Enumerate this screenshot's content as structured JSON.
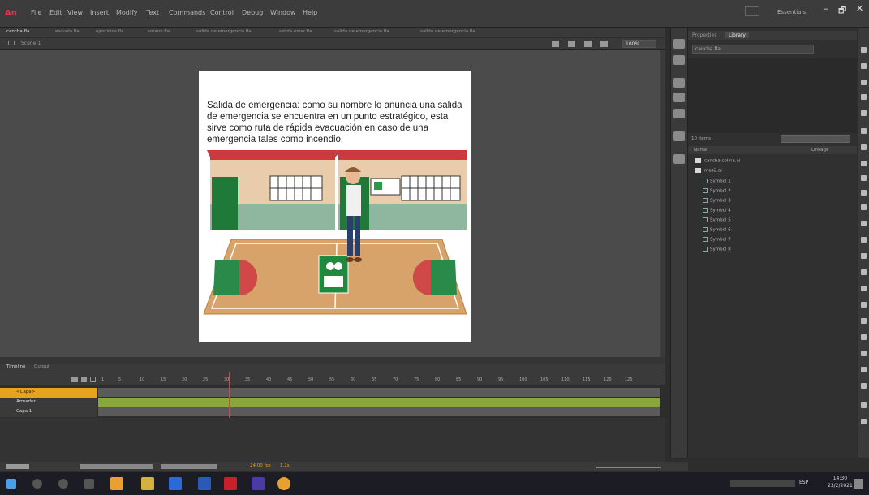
{
  "menubar": {
    "logo": "An",
    "items": [
      "File",
      "Edit",
      "View",
      "Insert",
      "Modify",
      "Text",
      "Commands",
      "Control",
      "Debug",
      "Window",
      "Help"
    ],
    "workspace": "Essentials",
    "win_buttons": [
      "–",
      "🗗",
      "✕"
    ]
  },
  "doc_tabs": [
    "cancha.fla",
    "escuela.fla",
    "ejercicios.fla",
    "sotano.fla",
    "salida de emergencia.fla",
    "salida emer.fla",
    "salida de emergencia.fla",
    "salida de emergencia.fla",
    "salida emergencia.fla"
  ],
  "scene": {
    "label": "Scene 1",
    "zoom": "100%"
  },
  "stage": {
    "text": "Salida de emergencia: como su nombre lo anuncia una salida de emergencia se encuentra en un punto estratégico, esta sirve como ruta de rápida evacuación en caso de una emergencia tales como incendio."
  },
  "panel": {
    "tabs": [
      "Properties",
      "Library"
    ],
    "library_file": "cancha.fla",
    "item_count": "10 items",
    "col_name": "Name",
    "col_linkage": "Linkage",
    "items": [
      {
        "type": "folder",
        "label": "cancha colina.ai"
      },
      {
        "type": "folder",
        "label": "mas2.ai"
      },
      {
        "type": "symbol",
        "label": "Symbol 1"
      },
      {
        "type": "symbol",
        "label": "Symbol 2"
      },
      {
        "type": "symbol",
        "label": "Symbol 3"
      },
      {
        "type": "symbol",
        "label": "Symbol 4"
      },
      {
        "type": "symbol",
        "label": "Symbol 5"
      },
      {
        "type": "symbol",
        "label": "Symbol 6"
      },
      {
        "type": "symbol",
        "label": "Symbol 7"
      },
      {
        "type": "symbol",
        "label": "Symbol 8"
      }
    ]
  },
  "timeline": {
    "tabs": [
      "Timeline",
      "Output"
    ],
    "frame_numbers": [
      "1",
      "5",
      "10",
      "15",
      "20",
      "25",
      "30",
      "35",
      "40",
      "45",
      "50",
      "55",
      "60",
      "65",
      "70",
      "75",
      "80",
      "85",
      "90",
      "95",
      "100",
      "105",
      "110",
      "115",
      "120",
      "125"
    ],
    "layers": [
      {
        "name": "<Capa>",
        "selected": true
      },
      {
        "name": "Armadur...",
        "selected": false
      },
      {
        "name": "Capa 1",
        "selected": false
      }
    ],
    "info_fps": "24.00 fps",
    "info_time": "1.2s"
  },
  "taskbar": {
    "time": "14:30",
    "date": "23/2/2021",
    "lang": "ESP"
  },
  "colors": {
    "app_bg": "#2d2d2d",
    "accent_orange": "#e0a020",
    "layer_green": "#8aa83a",
    "stage_bg": "#ffffff"
  }
}
